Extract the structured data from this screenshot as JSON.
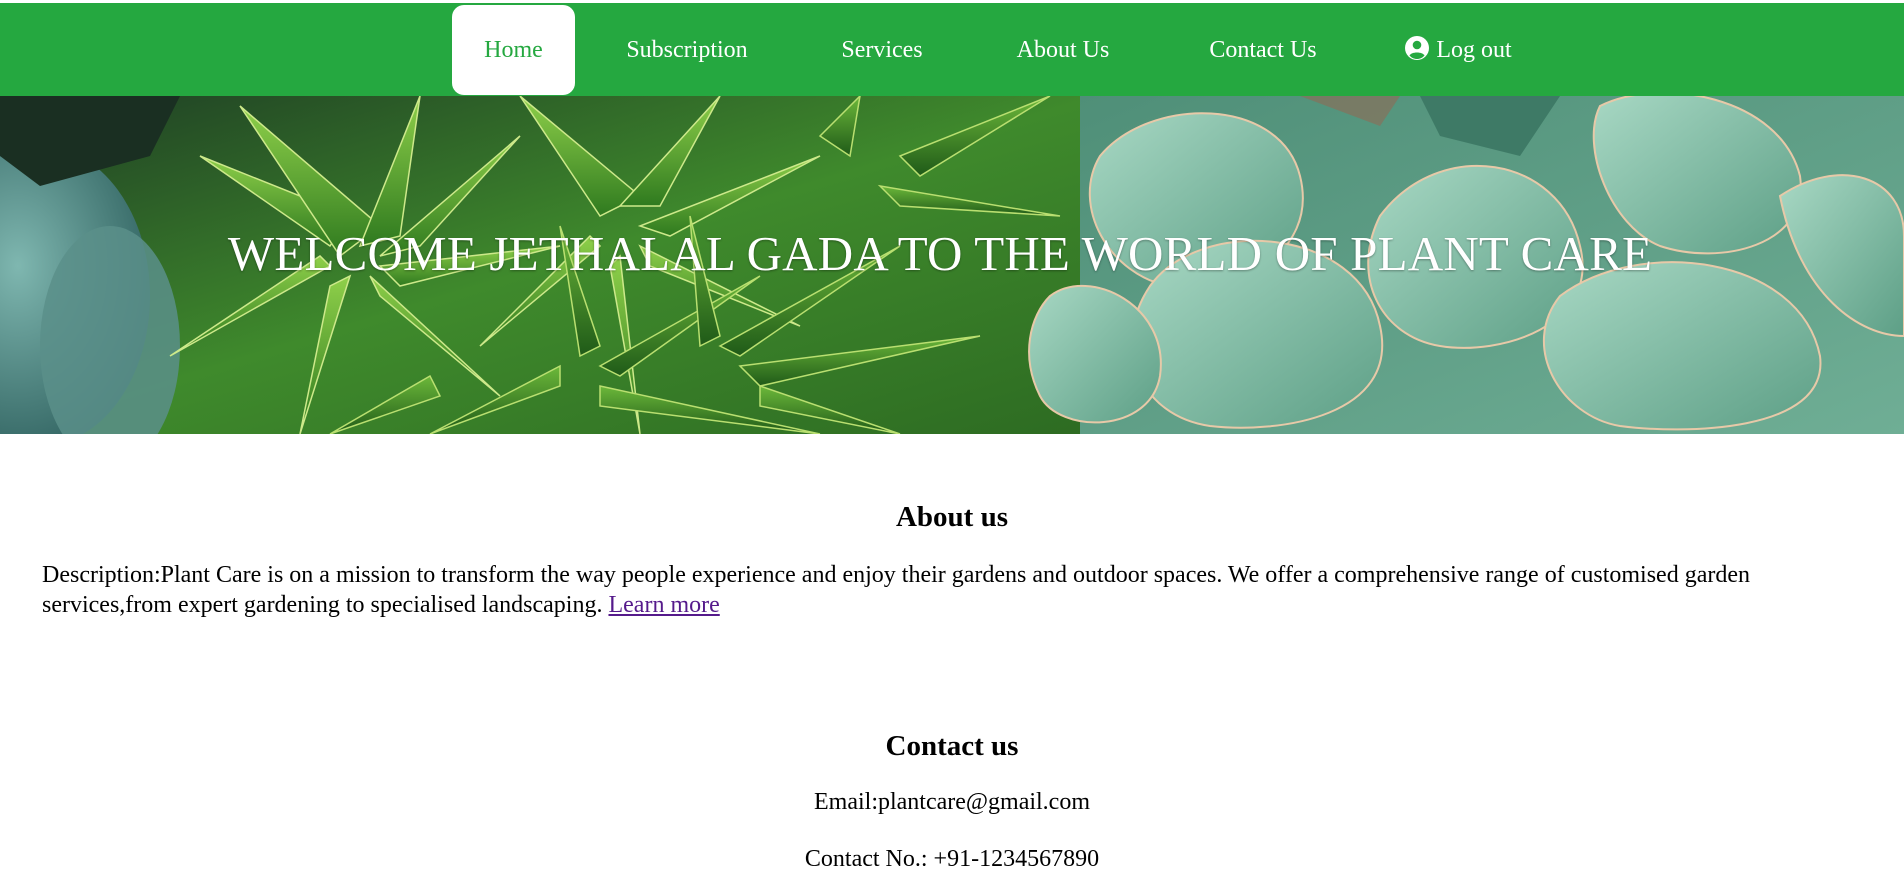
{
  "nav": {
    "items": [
      {
        "label": "Home",
        "active": true
      },
      {
        "label": "Subscription",
        "active": false
      },
      {
        "label": "Services",
        "active": false
      },
      {
        "label": "About Us",
        "active": false
      },
      {
        "label": "Contact Us",
        "active": false
      }
    ],
    "logout_label": "Log out",
    "logout_icon": "user-circle-icon"
  },
  "hero": {
    "title": "WELCOME JETHALAL GADA TO THE WORLD OF PLANT CARE"
  },
  "about": {
    "heading": "About us",
    "description": "Description:Plant Care is on a mission to transform the way people experience and enjoy their gardens and outdoor spaces. We offer a comprehensive range of customised garden services,from expert gardening to specialised landscaping.",
    "link_label": "Learn more"
  },
  "contact": {
    "heading": "Contact us",
    "email": "Email:plantcare@gmail.com",
    "phone": "Contact No.: +91-1234567890"
  },
  "colors": {
    "brand_green": "#25a840",
    "link_visited": "#551a8b"
  }
}
